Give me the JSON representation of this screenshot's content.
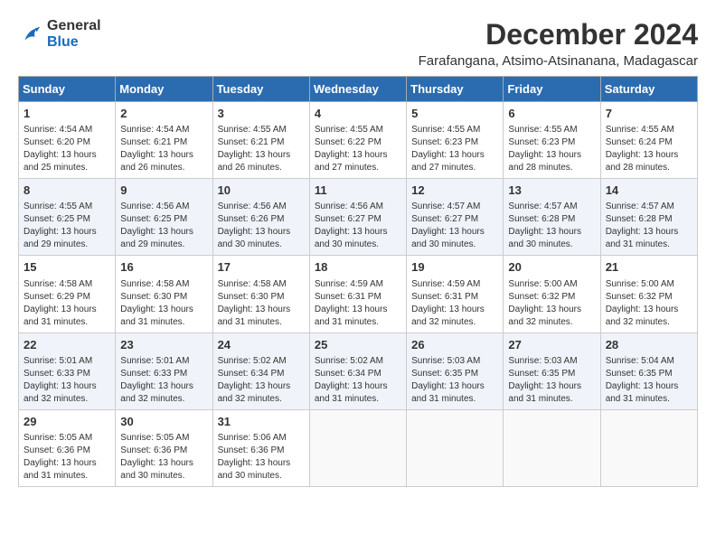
{
  "logo": {
    "general": "General",
    "blue": "Blue"
  },
  "title": "December 2024",
  "subtitle": "Farafangana, Atsimo-Atsinanana, Madagascar",
  "headers": [
    "Sunday",
    "Monday",
    "Tuesday",
    "Wednesday",
    "Thursday",
    "Friday",
    "Saturday"
  ],
  "weeks": [
    [
      {
        "day": "1",
        "info": "Sunrise: 4:54 AM\nSunset: 6:20 PM\nDaylight: 13 hours\nand 25 minutes."
      },
      {
        "day": "2",
        "info": "Sunrise: 4:54 AM\nSunset: 6:21 PM\nDaylight: 13 hours\nand 26 minutes."
      },
      {
        "day": "3",
        "info": "Sunrise: 4:55 AM\nSunset: 6:21 PM\nDaylight: 13 hours\nand 26 minutes."
      },
      {
        "day": "4",
        "info": "Sunrise: 4:55 AM\nSunset: 6:22 PM\nDaylight: 13 hours\nand 27 minutes."
      },
      {
        "day": "5",
        "info": "Sunrise: 4:55 AM\nSunset: 6:23 PM\nDaylight: 13 hours\nand 27 minutes."
      },
      {
        "day": "6",
        "info": "Sunrise: 4:55 AM\nSunset: 6:23 PM\nDaylight: 13 hours\nand 28 minutes."
      },
      {
        "day": "7",
        "info": "Sunrise: 4:55 AM\nSunset: 6:24 PM\nDaylight: 13 hours\nand 28 minutes."
      }
    ],
    [
      {
        "day": "8",
        "info": "Sunrise: 4:55 AM\nSunset: 6:25 PM\nDaylight: 13 hours\nand 29 minutes."
      },
      {
        "day": "9",
        "info": "Sunrise: 4:56 AM\nSunset: 6:25 PM\nDaylight: 13 hours\nand 29 minutes."
      },
      {
        "day": "10",
        "info": "Sunrise: 4:56 AM\nSunset: 6:26 PM\nDaylight: 13 hours\nand 30 minutes."
      },
      {
        "day": "11",
        "info": "Sunrise: 4:56 AM\nSunset: 6:27 PM\nDaylight: 13 hours\nand 30 minutes."
      },
      {
        "day": "12",
        "info": "Sunrise: 4:57 AM\nSunset: 6:27 PM\nDaylight: 13 hours\nand 30 minutes."
      },
      {
        "day": "13",
        "info": "Sunrise: 4:57 AM\nSunset: 6:28 PM\nDaylight: 13 hours\nand 30 minutes."
      },
      {
        "day": "14",
        "info": "Sunrise: 4:57 AM\nSunset: 6:28 PM\nDaylight: 13 hours\nand 31 minutes."
      }
    ],
    [
      {
        "day": "15",
        "info": "Sunrise: 4:58 AM\nSunset: 6:29 PM\nDaylight: 13 hours\nand 31 minutes."
      },
      {
        "day": "16",
        "info": "Sunrise: 4:58 AM\nSunset: 6:30 PM\nDaylight: 13 hours\nand 31 minutes."
      },
      {
        "day": "17",
        "info": "Sunrise: 4:58 AM\nSunset: 6:30 PM\nDaylight: 13 hours\nand 31 minutes."
      },
      {
        "day": "18",
        "info": "Sunrise: 4:59 AM\nSunset: 6:31 PM\nDaylight: 13 hours\nand 31 minutes."
      },
      {
        "day": "19",
        "info": "Sunrise: 4:59 AM\nSunset: 6:31 PM\nDaylight: 13 hours\nand 32 minutes."
      },
      {
        "day": "20",
        "info": "Sunrise: 5:00 AM\nSunset: 6:32 PM\nDaylight: 13 hours\nand 32 minutes."
      },
      {
        "day": "21",
        "info": "Sunrise: 5:00 AM\nSunset: 6:32 PM\nDaylight: 13 hours\nand 32 minutes."
      }
    ],
    [
      {
        "day": "22",
        "info": "Sunrise: 5:01 AM\nSunset: 6:33 PM\nDaylight: 13 hours\nand 32 minutes."
      },
      {
        "day": "23",
        "info": "Sunrise: 5:01 AM\nSunset: 6:33 PM\nDaylight: 13 hours\nand 32 minutes."
      },
      {
        "day": "24",
        "info": "Sunrise: 5:02 AM\nSunset: 6:34 PM\nDaylight: 13 hours\nand 32 minutes."
      },
      {
        "day": "25",
        "info": "Sunrise: 5:02 AM\nSunset: 6:34 PM\nDaylight: 13 hours\nand 31 minutes."
      },
      {
        "day": "26",
        "info": "Sunrise: 5:03 AM\nSunset: 6:35 PM\nDaylight: 13 hours\nand 31 minutes."
      },
      {
        "day": "27",
        "info": "Sunrise: 5:03 AM\nSunset: 6:35 PM\nDaylight: 13 hours\nand 31 minutes."
      },
      {
        "day": "28",
        "info": "Sunrise: 5:04 AM\nSunset: 6:35 PM\nDaylight: 13 hours\nand 31 minutes."
      }
    ],
    [
      {
        "day": "29",
        "info": "Sunrise: 5:05 AM\nSunset: 6:36 PM\nDaylight: 13 hours\nand 31 minutes."
      },
      {
        "day": "30",
        "info": "Sunrise: 5:05 AM\nSunset: 6:36 PM\nDaylight: 13 hours\nand 30 minutes."
      },
      {
        "day": "31",
        "info": "Sunrise: 5:06 AM\nSunset: 6:36 PM\nDaylight: 13 hours\nand 30 minutes."
      },
      {
        "day": "",
        "info": ""
      },
      {
        "day": "",
        "info": ""
      },
      {
        "day": "",
        "info": ""
      },
      {
        "day": "",
        "info": ""
      }
    ]
  ]
}
